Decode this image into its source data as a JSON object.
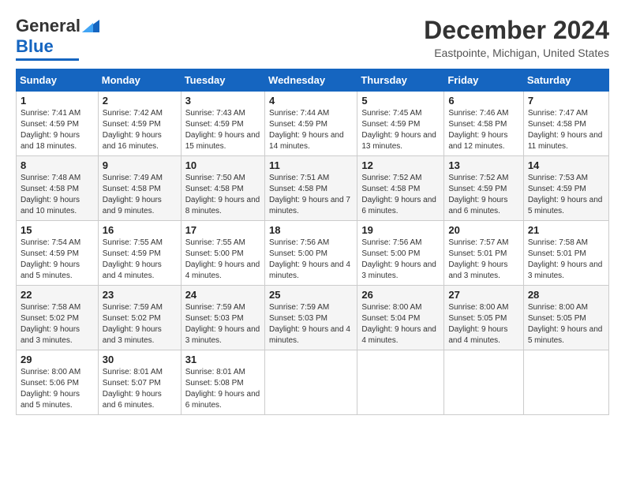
{
  "logo": {
    "text1": "General",
    "text2": "Blue"
  },
  "header": {
    "month": "December 2024",
    "location": "Eastpointe, Michigan, United States"
  },
  "days_of_week": [
    "Sunday",
    "Monday",
    "Tuesday",
    "Wednesday",
    "Thursday",
    "Friday",
    "Saturday"
  ],
  "weeks": [
    [
      {
        "day": "1",
        "sunrise": "7:41 AM",
        "sunset": "4:59 PM",
        "daylight": "9 hours and 18 minutes."
      },
      {
        "day": "2",
        "sunrise": "7:42 AM",
        "sunset": "4:59 PM",
        "daylight": "9 hours and 16 minutes."
      },
      {
        "day": "3",
        "sunrise": "7:43 AM",
        "sunset": "4:59 PM",
        "daylight": "9 hours and 15 minutes."
      },
      {
        "day": "4",
        "sunrise": "7:44 AM",
        "sunset": "4:59 PM",
        "daylight": "9 hours and 14 minutes."
      },
      {
        "day": "5",
        "sunrise": "7:45 AM",
        "sunset": "4:59 PM",
        "daylight": "9 hours and 13 minutes."
      },
      {
        "day": "6",
        "sunrise": "7:46 AM",
        "sunset": "4:58 PM",
        "daylight": "9 hours and 12 minutes."
      },
      {
        "day": "7",
        "sunrise": "7:47 AM",
        "sunset": "4:58 PM",
        "daylight": "9 hours and 11 minutes."
      }
    ],
    [
      {
        "day": "8",
        "sunrise": "7:48 AM",
        "sunset": "4:58 PM",
        "daylight": "9 hours and 10 minutes."
      },
      {
        "day": "9",
        "sunrise": "7:49 AM",
        "sunset": "4:58 PM",
        "daylight": "9 hours and 9 minutes."
      },
      {
        "day": "10",
        "sunrise": "7:50 AM",
        "sunset": "4:58 PM",
        "daylight": "9 hours and 8 minutes."
      },
      {
        "day": "11",
        "sunrise": "7:51 AM",
        "sunset": "4:58 PM",
        "daylight": "9 hours and 7 minutes."
      },
      {
        "day": "12",
        "sunrise": "7:52 AM",
        "sunset": "4:58 PM",
        "daylight": "9 hours and 6 minutes."
      },
      {
        "day": "13",
        "sunrise": "7:52 AM",
        "sunset": "4:59 PM",
        "daylight": "9 hours and 6 minutes."
      },
      {
        "day": "14",
        "sunrise": "7:53 AM",
        "sunset": "4:59 PM",
        "daylight": "9 hours and 5 minutes."
      }
    ],
    [
      {
        "day": "15",
        "sunrise": "7:54 AM",
        "sunset": "4:59 PM",
        "daylight": "9 hours and 5 minutes."
      },
      {
        "day": "16",
        "sunrise": "7:55 AM",
        "sunset": "4:59 PM",
        "daylight": "9 hours and 4 minutes."
      },
      {
        "day": "17",
        "sunrise": "7:55 AM",
        "sunset": "5:00 PM",
        "daylight": "9 hours and 4 minutes."
      },
      {
        "day": "18",
        "sunrise": "7:56 AM",
        "sunset": "5:00 PM",
        "daylight": "9 hours and 4 minutes."
      },
      {
        "day": "19",
        "sunrise": "7:56 AM",
        "sunset": "5:00 PM",
        "daylight": "9 hours and 3 minutes."
      },
      {
        "day": "20",
        "sunrise": "7:57 AM",
        "sunset": "5:01 PM",
        "daylight": "9 hours and 3 minutes."
      },
      {
        "day": "21",
        "sunrise": "7:58 AM",
        "sunset": "5:01 PM",
        "daylight": "9 hours and 3 minutes."
      }
    ],
    [
      {
        "day": "22",
        "sunrise": "7:58 AM",
        "sunset": "5:02 PM",
        "daylight": "9 hours and 3 minutes."
      },
      {
        "day": "23",
        "sunrise": "7:59 AM",
        "sunset": "5:02 PM",
        "daylight": "9 hours and 3 minutes."
      },
      {
        "day": "24",
        "sunrise": "7:59 AM",
        "sunset": "5:03 PM",
        "daylight": "9 hours and 3 minutes."
      },
      {
        "day": "25",
        "sunrise": "7:59 AM",
        "sunset": "5:03 PM",
        "daylight": "9 hours and 4 minutes."
      },
      {
        "day": "26",
        "sunrise": "8:00 AM",
        "sunset": "5:04 PM",
        "daylight": "9 hours and 4 minutes."
      },
      {
        "day": "27",
        "sunrise": "8:00 AM",
        "sunset": "5:05 PM",
        "daylight": "9 hours and 4 minutes."
      },
      {
        "day": "28",
        "sunrise": "8:00 AM",
        "sunset": "5:05 PM",
        "daylight": "9 hours and 5 minutes."
      }
    ],
    [
      {
        "day": "29",
        "sunrise": "8:00 AM",
        "sunset": "5:06 PM",
        "daylight": "9 hours and 5 minutes."
      },
      {
        "day": "30",
        "sunrise": "8:01 AM",
        "sunset": "5:07 PM",
        "daylight": "9 hours and 6 minutes."
      },
      {
        "day": "31",
        "sunrise": "8:01 AM",
        "sunset": "5:08 PM",
        "daylight": "9 hours and 6 minutes."
      },
      null,
      null,
      null,
      null
    ]
  ],
  "labels": {
    "sunrise": "Sunrise:",
    "sunset": "Sunset:",
    "daylight": "Daylight:"
  }
}
